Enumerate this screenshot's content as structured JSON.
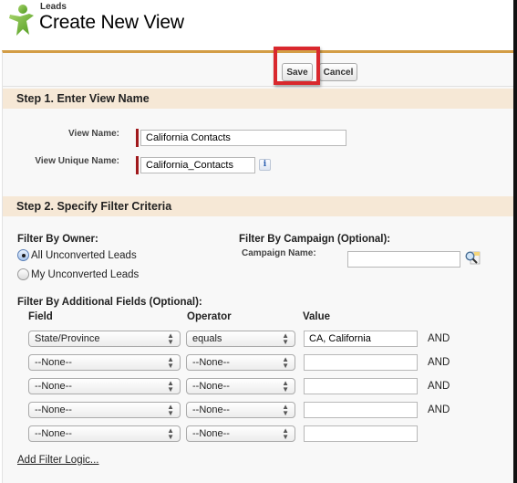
{
  "header": {
    "object_label": "Leads",
    "title": "Create New View",
    "logo_icon": "leads-person-icon"
  },
  "toolbar": {
    "save_label": "Save",
    "cancel_label": "Cancel",
    "highlight_color": "#d9282d"
  },
  "step1": {
    "heading": "Step 1. Enter View Name",
    "view_name_label": "View Name:",
    "view_name_value": "California Contacts",
    "unique_name_label": "View Unique Name:",
    "unique_name_value": "California_Contacts",
    "info_icon_glyph": "i"
  },
  "step2": {
    "heading": "Step 2. Specify Filter Criteria",
    "owner": {
      "label": "Filter By Owner:",
      "options": [
        {
          "label": "All Unconverted Leads",
          "checked": true
        },
        {
          "label": "My Unconverted Leads",
          "checked": false
        }
      ]
    },
    "campaign": {
      "label": "Filter By Campaign (Optional):",
      "name_label": "Campaign Name:",
      "name_value": "",
      "lookup_icon": "lookup-magnifier-icon"
    },
    "additional": {
      "label": "Filter By Additional Fields (Optional):",
      "columns": {
        "field": "Field",
        "operator": "Operator",
        "value": "Value"
      },
      "rows": [
        {
          "field": "State/Province",
          "operator": "equals",
          "value": "CA, California",
          "conjunction": "AND"
        },
        {
          "field": "--None--",
          "operator": "--None--",
          "value": "",
          "conjunction": "AND"
        },
        {
          "field": "--None--",
          "operator": "--None--",
          "value": "",
          "conjunction": "AND"
        },
        {
          "field": "--None--",
          "operator": "--None--",
          "value": "",
          "conjunction": "AND"
        },
        {
          "field": "--None--",
          "operator": "--None--",
          "value": "",
          "conjunction": ""
        }
      ]
    },
    "add_filter_logic_label": "Add Filter Logic..."
  }
}
